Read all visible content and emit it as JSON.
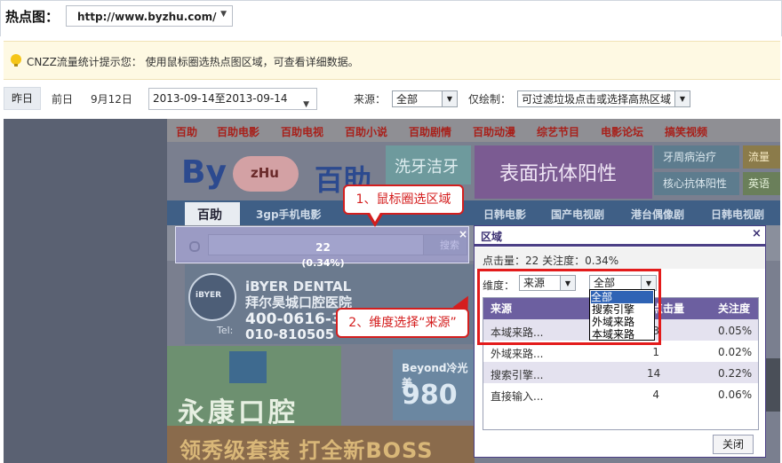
{
  "header": {
    "title": "热点图：",
    "url": "http://www.byzhu.com/"
  },
  "tip": {
    "text": "CNZZ流量统计提示您： 使用鼠标圈选热点图区域，可查看详细数据。"
  },
  "filters": {
    "yesterday": "昨日",
    "day_before": "前日",
    "date": "9月12日",
    "range": "2013-09-14至2013-09-14",
    "source_label": "来源：",
    "source_value": "全部",
    "draw_label": "仅绘制：",
    "draw_value": "可过滤垃圾点击或选择高热区域"
  },
  "site": {
    "nav": [
      "百助",
      "百助电影",
      "百助电视",
      "百助小说",
      "百助剧情",
      "百助动漫",
      "综艺节目",
      "电影论坛",
      "搞笑视频"
    ],
    "logo_en": "By",
    "logo_zhu": "zHu",
    "logo_cn": "百助",
    "ad1": "洗牙洁牙",
    "ad2": "表面抗体阳性",
    "ad3": "牙周病治疗",
    "ad4": "核心抗体阳性",
    "ad5": "流量",
    "ad6": "英语",
    "nav2": [
      "3gp手机电影",
      "日韩电影",
      "国产电视剧",
      "港台偶像剧",
      "日韩电视剧"
    ],
    "tab": "百助",
    "search_btn": "搜索",
    "dental_seal": "iBYER",
    "dental_name": "iBYER DENTAL",
    "dental_cn": "拜尔昊城口腔医院",
    "dental_tel_label": "Tel:",
    "dental_tel": "400-0616-3",
    "dental_tel2": "010-810505",
    "yk": "永康口腔",
    "beyond": "Beyond冷光美",
    "beyond_num": "980",
    "banner": "领秀级套装  打全新BOSS"
  },
  "selection": {
    "count": "22",
    "pct": "(0.34%)",
    "close": "×"
  },
  "callouts": {
    "c1": "1、鼠标圈选区域",
    "c2": "2、维度选择“来源”"
  },
  "panel": {
    "title": "区域",
    "close": "×",
    "stats": "点击量：22   关注度：0.34%",
    "dim_label": "维度：",
    "dim_value": "来源",
    "filter_value": "全部",
    "dropdown_options": [
      "全部",
      "搜索引擎",
      "外域来路",
      "本域来路"
    ],
    "columns": [
      "来源",
      "点击量",
      "关注度"
    ],
    "rows": [
      {
        "src": "本域来路...",
        "clicks": "3",
        "pct": "0.05%"
      },
      {
        "src": "外域来路...",
        "clicks": "1",
        "pct": "0.02%"
      },
      {
        "src": "搜索引擎...",
        "clicks": "14",
        "pct": "0.22%"
      },
      {
        "src": "直接输入...",
        "clicks": "4",
        "pct": "0.06%"
      }
    ],
    "close_btn": "关闭"
  }
}
